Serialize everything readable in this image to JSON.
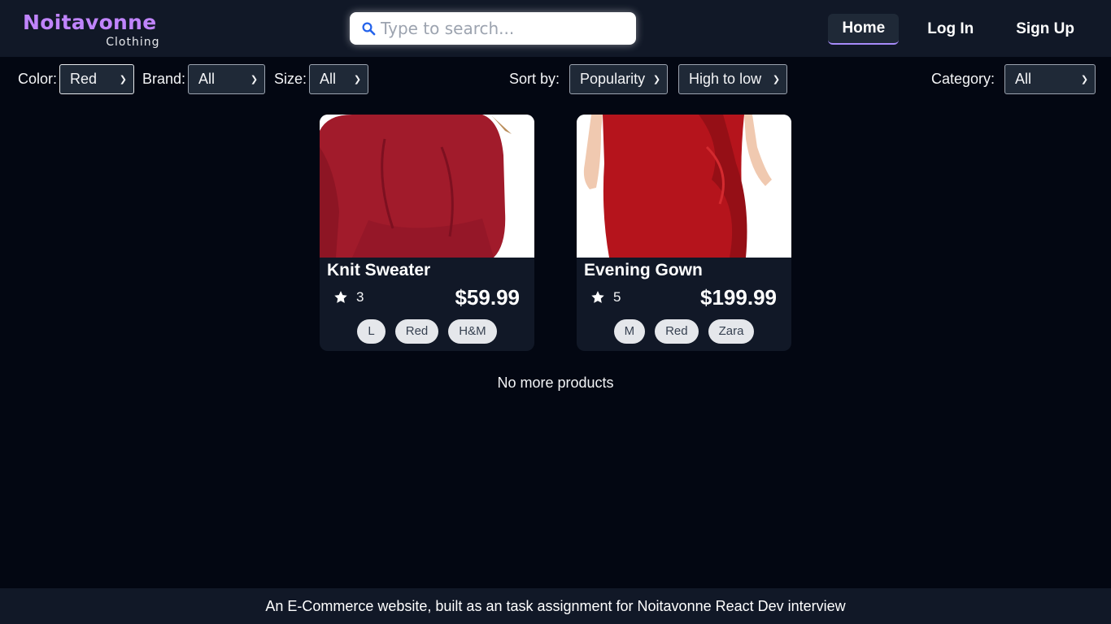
{
  "brand": {
    "title": "Noitavonne",
    "subtitle": "Clothing",
    "accent": "#c084fc"
  },
  "search": {
    "placeholder": "Type to search...",
    "value": ""
  },
  "nav": {
    "home": "Home",
    "login": "Log In",
    "signup": "Sign Up",
    "active": "Home"
  },
  "filters": {
    "color": {
      "label": "Color:",
      "value": "Red"
    },
    "brand": {
      "label": "Brand:",
      "value": "All"
    },
    "size": {
      "label": "Size:",
      "value": "All"
    },
    "sort": {
      "label": "Sort by:",
      "value": "Popularity",
      "order": "High to low"
    },
    "category": {
      "label": "Category:",
      "value": "All"
    }
  },
  "products": [
    {
      "name": "Knit Sweater",
      "rating": "3",
      "price": "$59.99",
      "tags": [
        "L",
        "Red",
        "H&M"
      ],
      "image_color": "#a11b2b"
    },
    {
      "name": "Evening Gown",
      "rating": "5",
      "price": "$199.99",
      "tags": [
        "M",
        "Red",
        "Zara"
      ],
      "image_color": "#b5141c"
    }
  ],
  "status": "No more products",
  "footer": "An E-Commerce website, built as an task assignment for Noitavonne React Dev interview"
}
